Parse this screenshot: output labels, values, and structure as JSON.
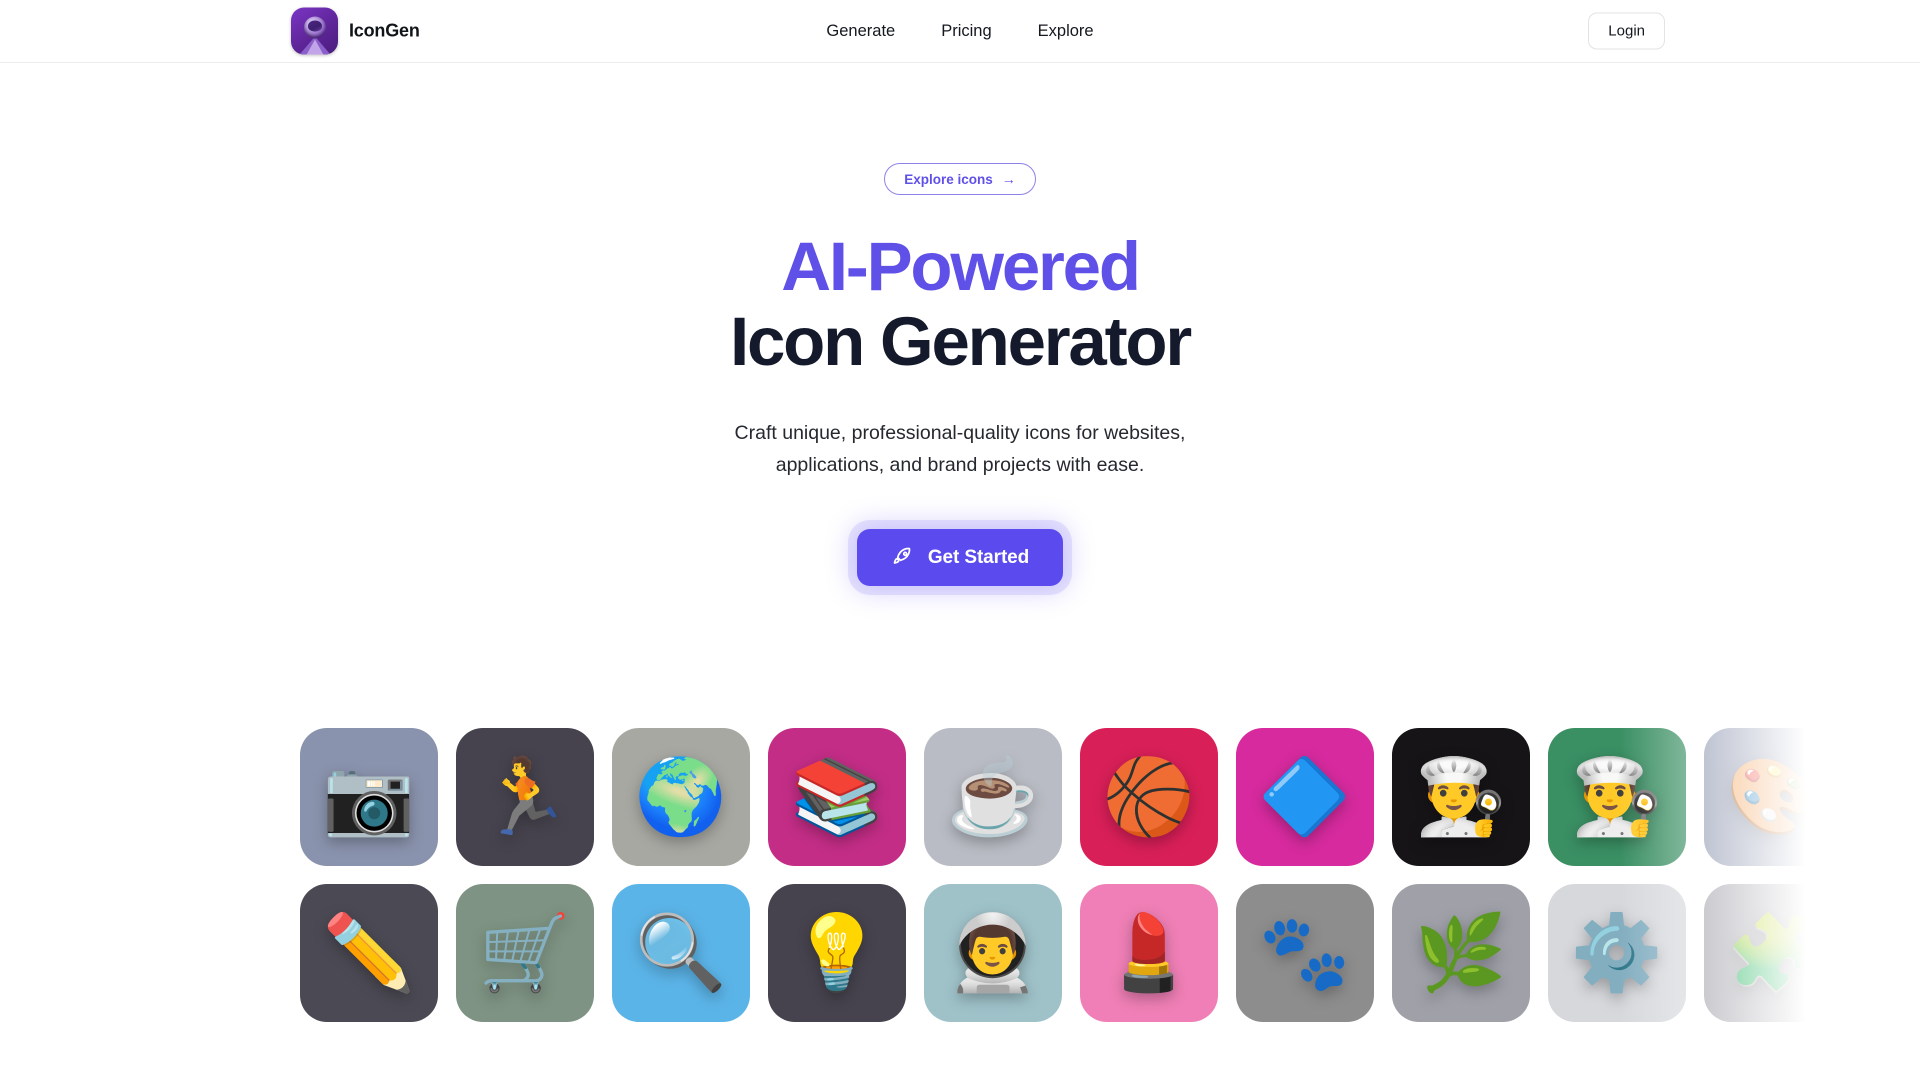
{
  "header": {
    "brand_name": "IconGen",
    "logo_icon": "astronaut-logo-icon",
    "nav": [
      {
        "label": "Generate"
      },
      {
        "label": "Pricing"
      },
      {
        "label": "Explore"
      }
    ],
    "login_label": "Login"
  },
  "hero": {
    "badge_label": "Explore icons",
    "badge_arrow": "→",
    "headline_line1": "AI-Powered",
    "headline_line2": "Icon Generator",
    "subtitle_line1": "Craft unique, professional-quality icons for websites,",
    "subtitle_line2": "applications, and brand projects with ease.",
    "cta_label": "Get Started",
    "cta_icon": "rocket-icon"
  },
  "colors": {
    "accent": "#5f50e8",
    "cta_background": "#5b4bee",
    "headline_dark": "#141a2b",
    "page_background": "#ffffff",
    "header_border": "#ececec"
  },
  "icon_gallery": {
    "rows": [
      [
        {
          "name": "camera-icon",
          "glyph": "📷",
          "bg": "#8a93ad"
        },
        {
          "name": "runner-icon",
          "glyph": "🏃",
          "bg": "#46434e"
        },
        {
          "name": "globe-icon",
          "glyph": "🌍",
          "bg": "#a8a8a3"
        },
        {
          "name": "books-icon",
          "glyph": "📚",
          "bg": "#c32d86"
        },
        {
          "name": "coffee-cup-icon",
          "glyph": "☕",
          "bg": "#b9bcc4"
        },
        {
          "name": "sports-jerseys-icon",
          "glyph": "🏀",
          "bg": "#d81f58"
        },
        {
          "name": "cube-3d-icon",
          "glyph": "🔷",
          "bg": "#d62a9e"
        },
        {
          "name": "chef-dark-icon",
          "glyph": "👨‍🍳",
          "bg": "#161417"
        },
        {
          "name": "chef-green-icon",
          "glyph": "👨‍🍳",
          "bg": "#3a8f63"
        },
        {
          "name": "grid-tile-overflow",
          "glyph": "🎨",
          "bg": "#8a93ad"
        }
      ],
      [
        {
          "name": "pencils-icon",
          "glyph": "✏️",
          "bg": "#4b4953"
        },
        {
          "name": "shopping-cart-icon",
          "glyph": "🛒",
          "bg": "#7e9383"
        },
        {
          "name": "magnifier-icon",
          "glyph": "🔍",
          "bg": "#5bb4e8"
        },
        {
          "name": "light-bulb-icon",
          "glyph": "💡",
          "bg": "#46434e"
        },
        {
          "name": "astronaut-icon",
          "glyph": "👨‍🚀",
          "bg": "#9fc2c9"
        },
        {
          "name": "lipstick-icon",
          "glyph": "💄",
          "bg": "#ef7fb6"
        },
        {
          "name": "paw-print-icon",
          "glyph": "🐾",
          "bg": "#8d8d8d"
        },
        {
          "name": "leaf-icon",
          "glyph": "🌿",
          "bg": "#9fa0a8"
        },
        {
          "name": "gears-icon",
          "glyph": "⚙️",
          "bg": "#d6d8dc"
        },
        {
          "name": "grid-tile-overflow",
          "glyph": "🧩",
          "bg": "#9fa0a8"
        }
      ]
    ]
  }
}
